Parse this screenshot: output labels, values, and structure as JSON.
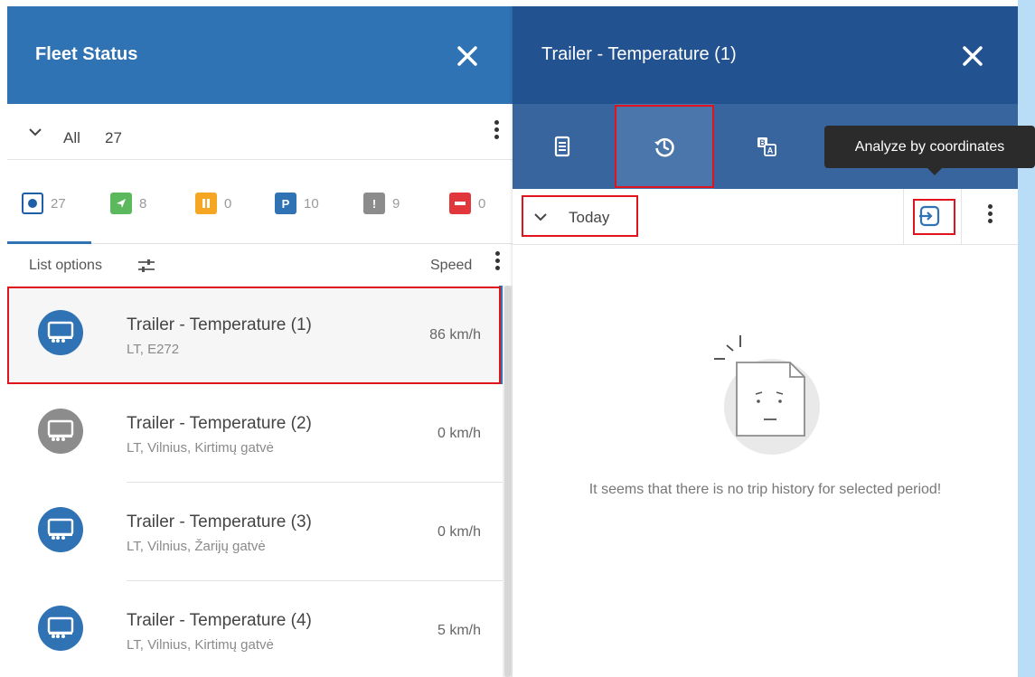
{
  "fleet_panel": {
    "title": "Fleet Status",
    "filter_label": "All",
    "filter_count": "27",
    "status_filters": [
      {
        "count": "27",
        "color": "#1f5fa8",
        "icon": "all-icon"
      },
      {
        "count": "8",
        "color": "#5cb85c",
        "icon": "navigation-arrow-icon"
      },
      {
        "count": "0",
        "color": "#f5a623",
        "icon": "pause-icon"
      },
      {
        "count": "10",
        "color": "#2f73b5",
        "icon": "parking-icon"
      },
      {
        "count": "9",
        "color": "#8c8c8c",
        "icon": "alert-icon"
      },
      {
        "count": "0",
        "color": "#e0363c",
        "icon": "stop-icon"
      }
    ],
    "list_options_label": "List options",
    "speed_label": "Speed",
    "vehicles": [
      {
        "name": "Trailer - Temperature (1)",
        "address": "LT, E272",
        "speed": "86 km/h",
        "status_color": "#2f73b5"
      },
      {
        "name": "Trailer - Temperature (2)",
        "address": "LT, Vilnius, Kirtimų gatvė",
        "speed": "0 km/h",
        "status_color": "#8c8c8c"
      },
      {
        "name": "Trailer - Temperature (3)",
        "address": "LT, Vilnius, Žarijų gatvė",
        "speed": "0 km/h",
        "status_color": "#2f73b5"
      },
      {
        "name": "Trailer - Temperature (4)",
        "address": "LT, Vilnius, Kirtimų gatvė",
        "speed": "5 km/h",
        "status_color": "#2f73b5"
      }
    ]
  },
  "detail_panel": {
    "title": "Trailer - Temperature (1)",
    "tabs": [
      {
        "icon": "document-icon"
      },
      {
        "icon": "history-icon"
      },
      {
        "icon": "translate-icon"
      }
    ],
    "period_label": "Today",
    "empty_message": "It seems that there is no trip history for selected period!",
    "tooltip": "Analyze by coordinates"
  },
  "colors": {
    "fleet_header": "#2f73b5",
    "detail_header": "#235291",
    "tabs_bar": "#38659e",
    "highlight": "#e0141c"
  }
}
